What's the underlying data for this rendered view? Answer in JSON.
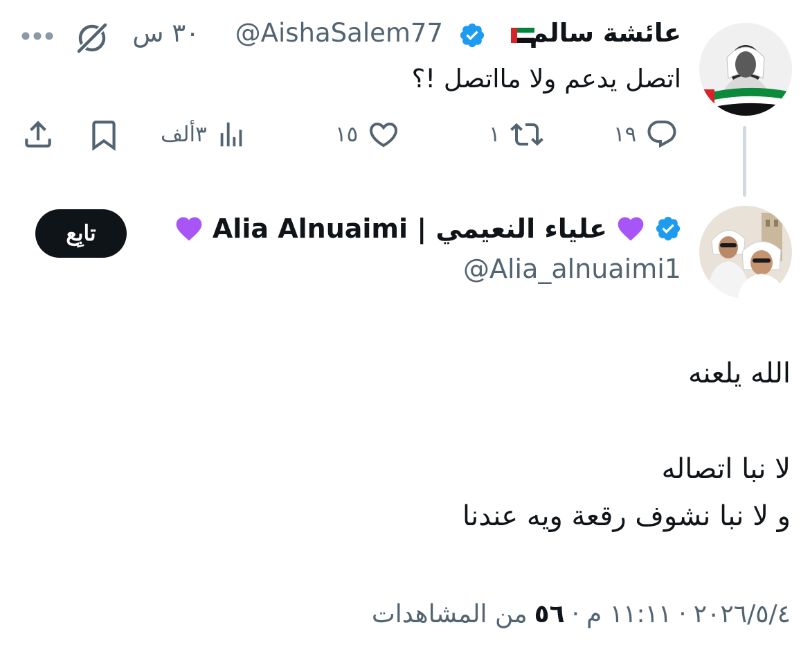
{
  "parent_tweet": {
    "author_name": "عائشة سالم",
    "flag": "🇦🇪",
    "verified": true,
    "handle": "@AishaSalem77",
    "time_sep": "·",
    "time": "٣٠ س",
    "text": "اتصل يدعم ولا مااتصل !؟",
    "actions": {
      "replies": "١٩",
      "reposts": "١",
      "likes": "١٥",
      "views": "٣ألف"
    }
  },
  "reply_tweet": {
    "author_name": "💜 علياء النعيمي | Alia Alnuaimi 💜",
    "author_name_text": "علياء النعيمي | Alia Alnuaimi",
    "verified": true,
    "handle": "@Alia_alnuaimi1",
    "follow_label": "تابِع",
    "body_lines": [
      "الله يلعنه",
      "لا نبا اتصاله",
      "و لا نبا نشوف رقعة ويه عندنا"
    ],
    "meta": {
      "date": "٢٠٢٦/٥/٤",
      "time": "١١:١١ م",
      "views_count": "٥٦",
      "views_label": "من المشاهدات",
      "sep": "·"
    }
  },
  "colors": {
    "text_primary": "#0f1419",
    "text_secondary": "#536471",
    "verified_blue": "#1d9bf0",
    "follow_button_bg": "#0f1419",
    "thread_line": "#cfd9de",
    "heart_purple": "#a855f7"
  },
  "icons": {
    "reply": "reply-icon",
    "repost": "repost-icon",
    "like": "heart-icon",
    "views": "views-chart-icon",
    "bookmark": "bookmark-icon",
    "share": "share-icon",
    "grok": "grok-icon",
    "more": "more-icon"
  }
}
